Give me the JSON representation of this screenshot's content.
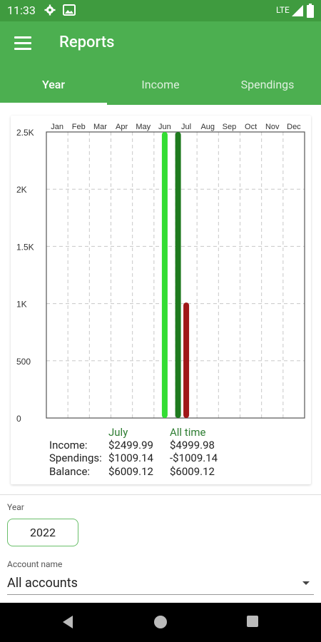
{
  "status": {
    "time": "11:33",
    "network": "LTE"
  },
  "app": {
    "title": "Reports"
  },
  "tabs": [
    {
      "label": "Year"
    },
    {
      "label": "Income"
    },
    {
      "label": "Spendings"
    }
  ],
  "chart_data": {
    "type": "bar",
    "categories": [
      "Jan",
      "Feb",
      "Mar",
      "Apr",
      "May",
      "Jun",
      "Jul",
      "Aug",
      "Sep",
      "Oct",
      "Nov",
      "Dec"
    ],
    "y_tick_labels": [
      "0",
      "500",
      "1K",
      "1.5K",
      "2K",
      "2.5K"
    ],
    "ylim": [
      0,
      2500
    ],
    "grid": true,
    "series": [
      {
        "color": "#33dd33",
        "values": [
          0,
          0,
          0,
          0,
          0,
          2500,
          0,
          0,
          0,
          0,
          0,
          0
        ]
      },
      {
        "color": "#1e7a1e",
        "values": [
          0,
          0,
          0,
          0,
          0,
          0,
          2500,
          0,
          0,
          0,
          0,
          0
        ]
      },
      {
        "color": "#a01818",
        "values": [
          0,
          0,
          0,
          0,
          0,
          0,
          1009.14,
          0,
          0,
          0,
          0,
          0
        ]
      }
    ]
  },
  "summary": {
    "col1_header": "July",
    "col2_header": "All time",
    "rows": [
      {
        "label": "Income:",
        "month": "$2499.99",
        "all": "$4999.98"
      },
      {
        "label": "Spendings:",
        "month": "$1009.14",
        "all": "-$1009.14"
      },
      {
        "label": "Balance:",
        "month": "$6009.12",
        "all": "$6009.12"
      }
    ]
  },
  "filters": {
    "year_label": "Year",
    "year_value": "2022",
    "account_label": "Account name",
    "account_value": "All accounts"
  },
  "colors": {
    "primary": "#4caf50",
    "status": "#3f9b3f",
    "income": "#33dd33",
    "alltime": "#1e7a1e",
    "spending": "#a01818"
  }
}
